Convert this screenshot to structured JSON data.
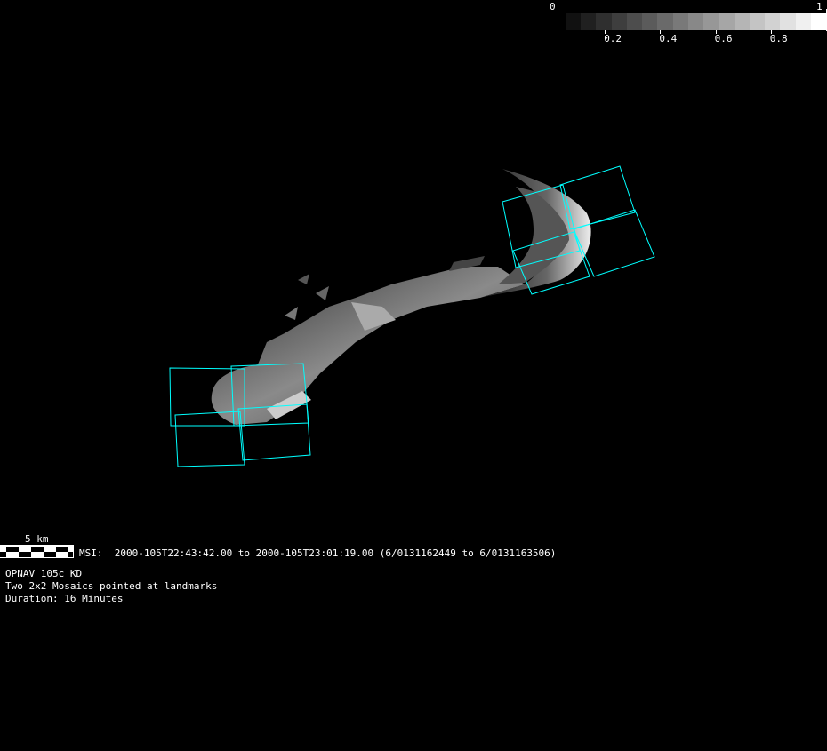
{
  "colorbar": {
    "min_label": "0",
    "max_label": "1",
    "tick_labels": [
      "0.2",
      "0.4",
      "0.6",
      "0.8"
    ],
    "tick_values": [
      0.2,
      0.4,
      0.6,
      0.8
    ],
    "segments": 17
  },
  "scale_bar": {
    "label": "5 km"
  },
  "msi_line": "MSI:  2000-105T22:43:42.00 to 2000-105T23:01:19.00 (6/0131162449 to 6/0131163506)",
  "info": {
    "title": "OPNAV 105c KD",
    "description": "Two 2x2 Mosaics pointed at landmarks",
    "duration": "Duration: 16 Minutes"
  },
  "colors": {
    "footprint": "#00ffff",
    "background": "#000000"
  }
}
